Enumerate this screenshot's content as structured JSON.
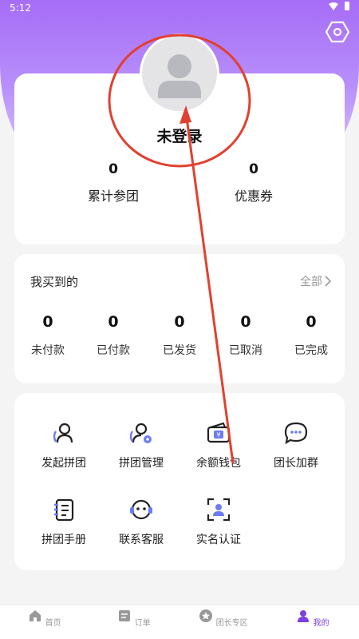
{
  "status": {
    "time": "5:12"
  },
  "profile": {
    "username": "未登录",
    "stats": [
      {
        "value": "0",
        "label": "累计参团"
      },
      {
        "value": "0",
        "label": "优惠券"
      }
    ]
  },
  "orders": {
    "title": "我买到的",
    "all_label": "全部",
    "items": [
      {
        "value": "0",
        "label": "未付款"
      },
      {
        "value": "0",
        "label": "已付款"
      },
      {
        "value": "0",
        "label": "已发货"
      },
      {
        "value": "0",
        "label": "已取消"
      },
      {
        "value": "0",
        "label": "已完成"
      }
    ]
  },
  "tools": [
    {
      "label": "发起拼团",
      "icon": "person-add-icon"
    },
    {
      "label": "拼团管理",
      "icon": "group-settings-icon"
    },
    {
      "label": "余额钱包",
      "icon": "wallet-icon"
    },
    {
      "label": "团长加群",
      "icon": "chat-bubble-icon"
    },
    {
      "label": "拼团手册",
      "icon": "notebook-icon"
    },
    {
      "label": "联系客服",
      "icon": "headset-icon"
    },
    {
      "label": "实名认证",
      "icon": "id-scan-icon"
    }
  ],
  "tabbar": {
    "items": [
      {
        "label": "首页",
        "icon": "home-icon"
      },
      {
        "label": "订单",
        "icon": "order-icon"
      },
      {
        "label": "团长专区",
        "icon": "star-icon"
      },
      {
        "label": "我的",
        "icon": "user-icon"
      }
    ],
    "active_index": 3
  },
  "colors": {
    "accent": "#7b3fe4",
    "header": "#a66cf7",
    "annotation": "#e2402f"
  }
}
